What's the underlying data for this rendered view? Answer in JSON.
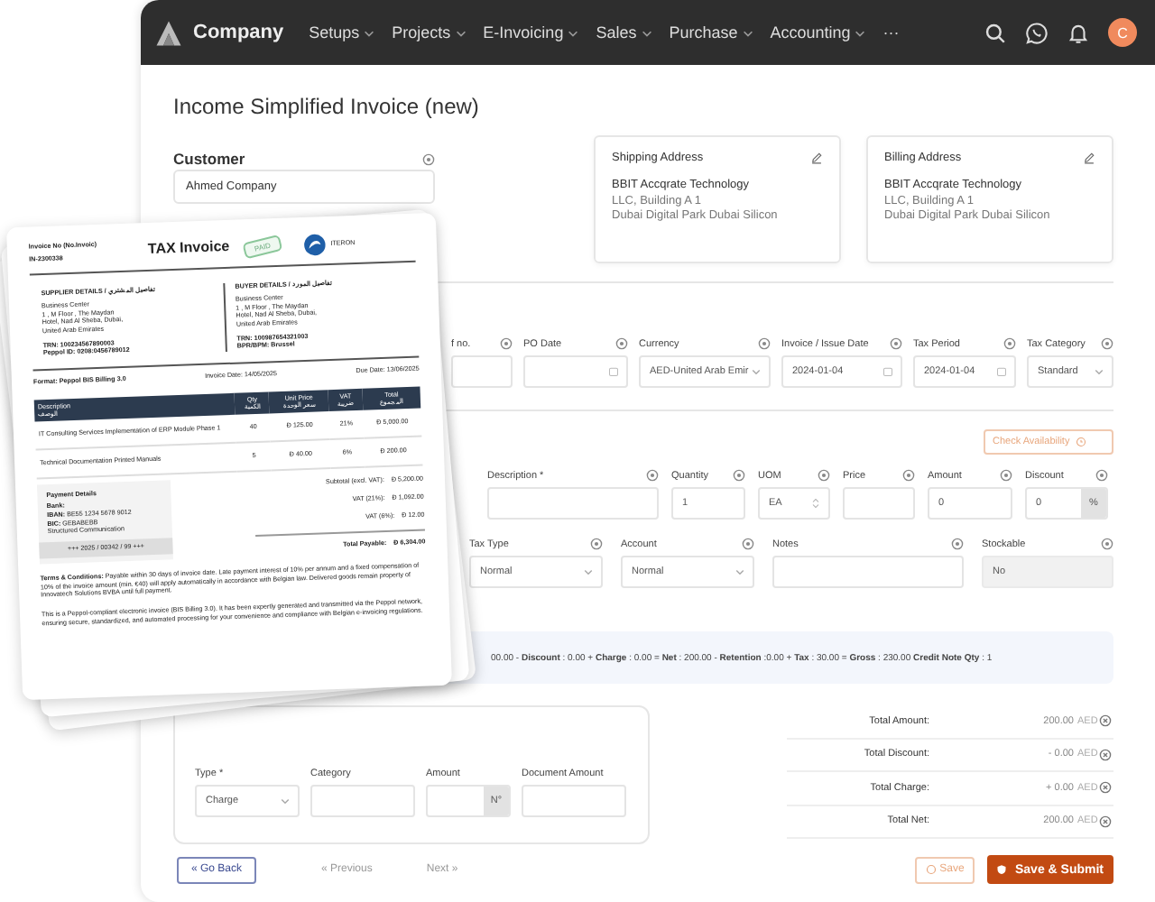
{
  "nav": {
    "brand": "Company",
    "menu": [
      {
        "label": "Setups"
      },
      {
        "label": "Projects"
      },
      {
        "label": "E-Invoicing"
      },
      {
        "label": "Sales"
      },
      {
        "label": "Purchase"
      },
      {
        "label": "Accounting"
      }
    ],
    "more": "···",
    "avatar": "C"
  },
  "page_title": "Income Simplified Invoice (new)",
  "customer": {
    "label": "Customer",
    "value": "Ahmed Company"
  },
  "addresses": [
    {
      "title": "Shipping Address",
      "lines": [
        "BBIT Accqrate Technology",
        "LLC, Building A 1",
        "Dubai Digital Park Dubai Silicon"
      ]
    },
    {
      "title": "Billing Address",
      "lines": [
        "BBIT Accqrate Technology",
        "LLC, Building A 1",
        "Dubai Digital Park Dubai Silicon"
      ]
    }
  ],
  "header_fields": [
    {
      "label": "f no.",
      "kind": "text"
    },
    {
      "label": "PO Date",
      "kind": "date"
    },
    {
      "label": "Currency",
      "value": "AED-United Arab Emir",
      "kind": "select"
    },
    {
      "label": "Invoice / Issue Date",
      "value": "2024-01-04",
      "kind": "date"
    },
    {
      "label": "Tax Period",
      "value": "2024-01-04",
      "kind": "date"
    },
    {
      "label": "Tax Category",
      "value": "Standard",
      "kind": "select"
    }
  ],
  "check_button": "Check Availability",
  "line_fields": [
    {
      "label": "Description *",
      "kind": "text"
    },
    {
      "label": "Quantity",
      "value": "1",
      "kind": "text"
    },
    {
      "label": "UOM",
      "value": "EA",
      "kind": "stepper"
    },
    {
      "label": "Price",
      "kind": "text"
    },
    {
      "label": "Amount",
      "value": "0",
      "kind": "text"
    },
    {
      "label": "Discount",
      "value": "0",
      "kind": "suffix",
      "suffix": "%"
    }
  ],
  "line_fields_2": [
    {
      "label": "Tax Type",
      "value": "Normal",
      "kind": "select",
      "disabled": false
    },
    {
      "label": "Account",
      "value": "Normal",
      "kind": "select",
      "disabled": false
    },
    {
      "label": "Notes",
      "kind": "text",
      "disabled": false
    },
    {
      "label": "Stockable",
      "value": "No",
      "kind": "text",
      "disabled": true
    }
  ],
  "summary": "00.00 - **Discount** : 0.00 + **Charge** : 0.00 = **Net** : 200.00 - **Retention** :0.00 + **Tax** : 30.00 = **Gross** : 230.00 **Credit Note Qty** : 1",
  "charge_fields": [
    {
      "label": "Type *",
      "value": "Charge",
      "kind": "select"
    },
    {
      "label": "Category",
      "kind": "text"
    },
    {
      "label": "Amount",
      "kind": "suffix",
      "suffix": "N°"
    },
    {
      "label": "Document Amount",
      "kind": "text"
    }
  ],
  "totals": [
    {
      "label": "Total Amount:",
      "value": "200.00",
      "unit": "AED"
    },
    {
      "label": "Total Discount:",
      "value": "- 0.00",
      "unit": "AED"
    },
    {
      "label": "Total Charge:",
      "value": "+ 0.00",
      "unit": "AED"
    },
    {
      "label": "Total Net:",
      "value": "200.00",
      "unit": "AED"
    }
  ],
  "footer": {
    "back": "« Go Back",
    "previous": "« Previous",
    "next": "Next »",
    "save": "Save",
    "submit": "Save & Submit"
  },
  "invoice": {
    "number_label": "Invoice No (No.Invoic)",
    "number": "IN-2300338",
    "title": "TAX Invoice",
    "stamp": "PAID",
    "logo_text": "ITERON",
    "supplier": {
      "heading": "SUPPLIER DETAILS / تفاصيل المشتري",
      "lines": [
        "Business Center",
        "1 , M Floor , The Maydan",
        "Hotel, Nad Al Sheba, Dubai,",
        "United Arab Emirates"
      ],
      "ids": [
        "TRN: 100234567890003",
        "Peppol ID: 0208:0456789012"
      ]
    },
    "buyer": {
      "heading": "BUYER DETAILS / تفاصيل المورد",
      "lines": [
        "Business Center",
        "1 , M Floor , The Maydan",
        "Hotel, Nad Al Sheba, Dubai,",
        "United Arab Emirates"
      ],
      "ids": [
        "TRN: 100987654321003",
        "BPR/BPM: Brussel"
      ]
    },
    "format": "Format: Peppol BIS Billing 3.0",
    "invoice_date": "Invoice Date: 14/05/2025",
    "due_date": "Due Date: 13/06/2025",
    "columns": [
      {
        "label": "Description",
        "sub": "الوصف"
      },
      {
        "label": "Qty",
        "sub": "الكمية"
      },
      {
        "label": "Unit Price",
        "sub": "سعر الوحدة"
      },
      {
        "label": "VAT",
        "sub": "ضريبة"
      },
      {
        "label": "Total",
        "sub": "المجموع"
      }
    ],
    "rows": [
      [
        "IT Consulting Services Implementation of ERP Module Phase 1",
        "40",
        "Đ 125.00",
        "21%",
        "Đ 5,000.00"
      ],
      [
        "Technical Documentation Printed Manuals",
        "5",
        "Đ 40.00",
        "6%",
        "Đ 200.00"
      ]
    ],
    "totals": [
      {
        "label": "Subtotal (excl. VAT):",
        "value": "Đ 5,200.00",
        "kind": "line"
      },
      {
        "label": "VAT (21%):",
        "value": "Đ 1,092.00",
        "kind": "line"
      },
      {
        "label": "VAT (6%):",
        "value": "Đ 12.00",
        "kind": "line"
      },
      {
        "label": "Total Payable:",
        "value": "Đ 6,304.00",
        "kind": "grand"
      }
    ],
    "payment": {
      "heading": "Payment Details",
      "lines": [
        "**Bank:**",
        "**IBAN:** BE55 1234 5678 9012",
        "**BIC:** GEBABEBB",
        "Structured Communication"
      ],
      "reference": "+++ 2025 / 00342 / 99 +++"
    },
    "terms": "**Terms & Conditions:** Payable within 30 days of invoice date. Late payment interest of 10% per annum and a fixed compensation of 10% of the invoice amount (min. €40) will apply automatically in accordance with Belgian law. Delivered goods remain property of Innovatech Solutions BVBA until full payment.",
    "note": "This is a Peppol-compliant electronic invoice (BIS Billing 3.0). It has been expertly generated and transmitted via the Peppol network, ensuring secure, standardized, and automated processing for your convenience and compliance with Belgian e-invoicing regulations."
  }
}
